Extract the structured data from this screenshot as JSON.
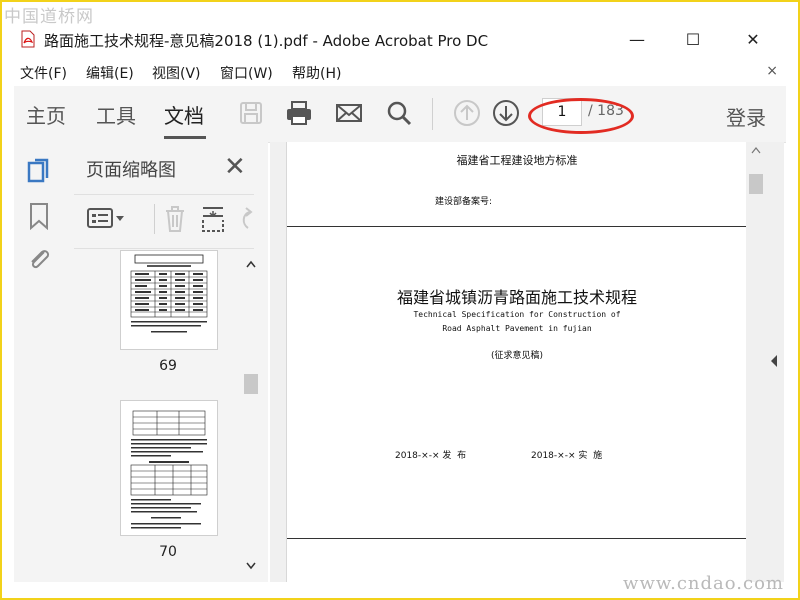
{
  "watermark": {
    "top": "中国道桥网",
    "bottom": "www.cndao.com"
  },
  "window": {
    "title": "路面施工技术规程-意见稿2018 (1).pdf - Adobe Acrobat Pro DC",
    "minimize": "—",
    "maximize": "☐",
    "close": "✕"
  },
  "menu": {
    "items": [
      "文件(F)",
      "编辑(E)",
      "视图(V)",
      "窗口(W)",
      "帮助(H)"
    ],
    "close": "×"
  },
  "toolbar": {
    "tabs": [
      "主页",
      "工具",
      "文档"
    ],
    "active_tab": "文档",
    "page_current": "1",
    "page_total": "/ 183",
    "login": "登录"
  },
  "thumbnails": {
    "title": "页面缩略图",
    "close": "✕",
    "pages": [
      "69",
      "70"
    ]
  },
  "document": {
    "header": "福建省工程建设地方标准",
    "record_no": "建设部备案号:",
    "main_title": "福建省城镇沥青路面施工技术规程",
    "en_title_1": "Technical Specification for Construction of",
    "en_title_2": "Road Asphalt Pavement in fujian",
    "draft_note": "(征求意见稿)",
    "publish": "2018-×-× 发  布",
    "implement": "2018-×-× 实  施"
  },
  "colors": {
    "accent_blue": "#3a78c2",
    "annotation_red": "#e22b22",
    "frame_yellow": "#f2d21a"
  }
}
